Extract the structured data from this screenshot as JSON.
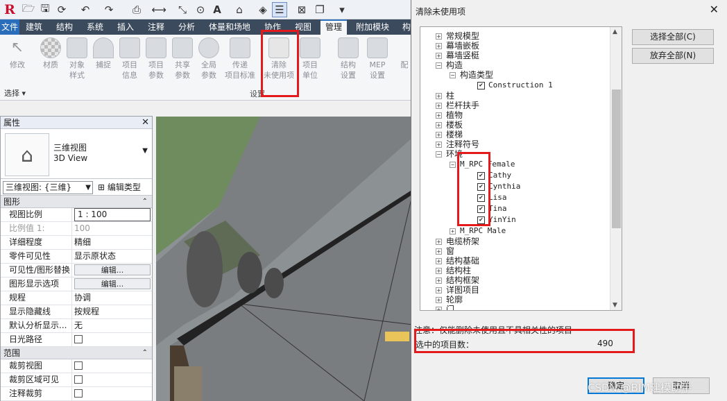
{
  "quick_access": {
    "logo": "R"
  },
  "tabs": [
    "文件",
    "建筑",
    "结构",
    "系统",
    "插入",
    "注释",
    "分析",
    "体量和场地",
    "协作",
    "视图",
    "管理",
    "附加模块",
    "构"
  ],
  "ribbon": {
    "buttons": [
      {
        "label": "修改"
      },
      {
        "label": "材质"
      },
      {
        "label": "对象\n样式"
      },
      {
        "label": "捕捉"
      },
      {
        "label": "项目\n信息"
      },
      {
        "label": "项目\n参数"
      },
      {
        "label": "共享\n参数"
      },
      {
        "label": "全局\n参数"
      },
      {
        "label": "传递\n项目标准"
      },
      {
        "label": "清除\n未使用项"
      },
      {
        "label": "项目\n单位"
      },
      {
        "label": "结构\n设置"
      },
      {
        "label": "MEP\n设置"
      },
      {
        "label": "配"
      }
    ],
    "panel_select": "选择 ▾",
    "panel_settings": "设置"
  },
  "properties": {
    "title": "属性",
    "type_name_cn": "三维视图",
    "type_name_en": "3D View",
    "view_selector": "三维视图: {三维}",
    "edit_type": "编辑类型",
    "sections": [
      {
        "name": "图形",
        "rows": [
          {
            "key": "视图比例",
            "value": "1 : 100"
          },
          {
            "key": "比例值 1:",
            "value": "100"
          },
          {
            "key": "详细程度",
            "value": "精细"
          },
          {
            "key": "零件可见性",
            "value": "显示原状态"
          },
          {
            "key": "可见性/图形替换",
            "value": "编辑..."
          },
          {
            "key": "图形显示选项",
            "value": "编辑..."
          },
          {
            "key": "规程",
            "value": "协调"
          },
          {
            "key": "显示隐藏线",
            "value": "按规程"
          },
          {
            "key": "默认分析显示...",
            "value": "无"
          },
          {
            "key": "日光路径",
            "value": ""
          }
        ]
      },
      {
        "name": "范围",
        "rows": [
          {
            "key": "裁剪视图",
            "value": ""
          },
          {
            "key": "裁剪区域可见",
            "value": ""
          },
          {
            "key": "注释裁剪",
            "value": ""
          }
        ]
      }
    ]
  },
  "dialog": {
    "title": "清除未使用项",
    "tree": [
      {
        "label": "常规模型"
      },
      {
        "label": "幕墙嵌板"
      },
      {
        "label": "幕墙竖梃"
      },
      {
        "label": "构造"
      },
      {
        "label": "构造类型"
      },
      {
        "label": "Construction 1"
      },
      {
        "label": "柱"
      },
      {
        "label": "栏杆扶手"
      },
      {
        "label": "植物"
      },
      {
        "label": "楼板"
      },
      {
        "label": "楼梯"
      },
      {
        "label": "注释符号"
      },
      {
        "label": "环境"
      },
      {
        "label": "M_RPC Female"
      },
      {
        "label": "Cathy"
      },
      {
        "label": "Cynthia"
      },
      {
        "label": "Lisa"
      },
      {
        "label": "Tina"
      },
      {
        "label": "YinYin"
      },
      {
        "label": "M_RPC Male"
      },
      {
        "label": "电缆桥架"
      },
      {
        "label": "窗"
      },
      {
        "label": "结构基础"
      },
      {
        "label": "结构柱"
      },
      {
        "label": "结构框架"
      },
      {
        "label": "详图项目"
      },
      {
        "label": "轮廓"
      },
      {
        "label": "门"
      }
    ],
    "check_all": "选择全部(C)",
    "uncheck_all": "放弃全部(N)",
    "note": "注意：仅能删除未使用且不具相关性的项目",
    "selected_count_label": "选中的项目数：",
    "selected_count": "490",
    "ok": "确定",
    "cancel": "取消"
  },
  "watermark": "CSDN @BIM建模助手",
  "colors": {
    "highlight_box": "#e3191c",
    "tab_active_accent": "#2a6ebb"
  }
}
